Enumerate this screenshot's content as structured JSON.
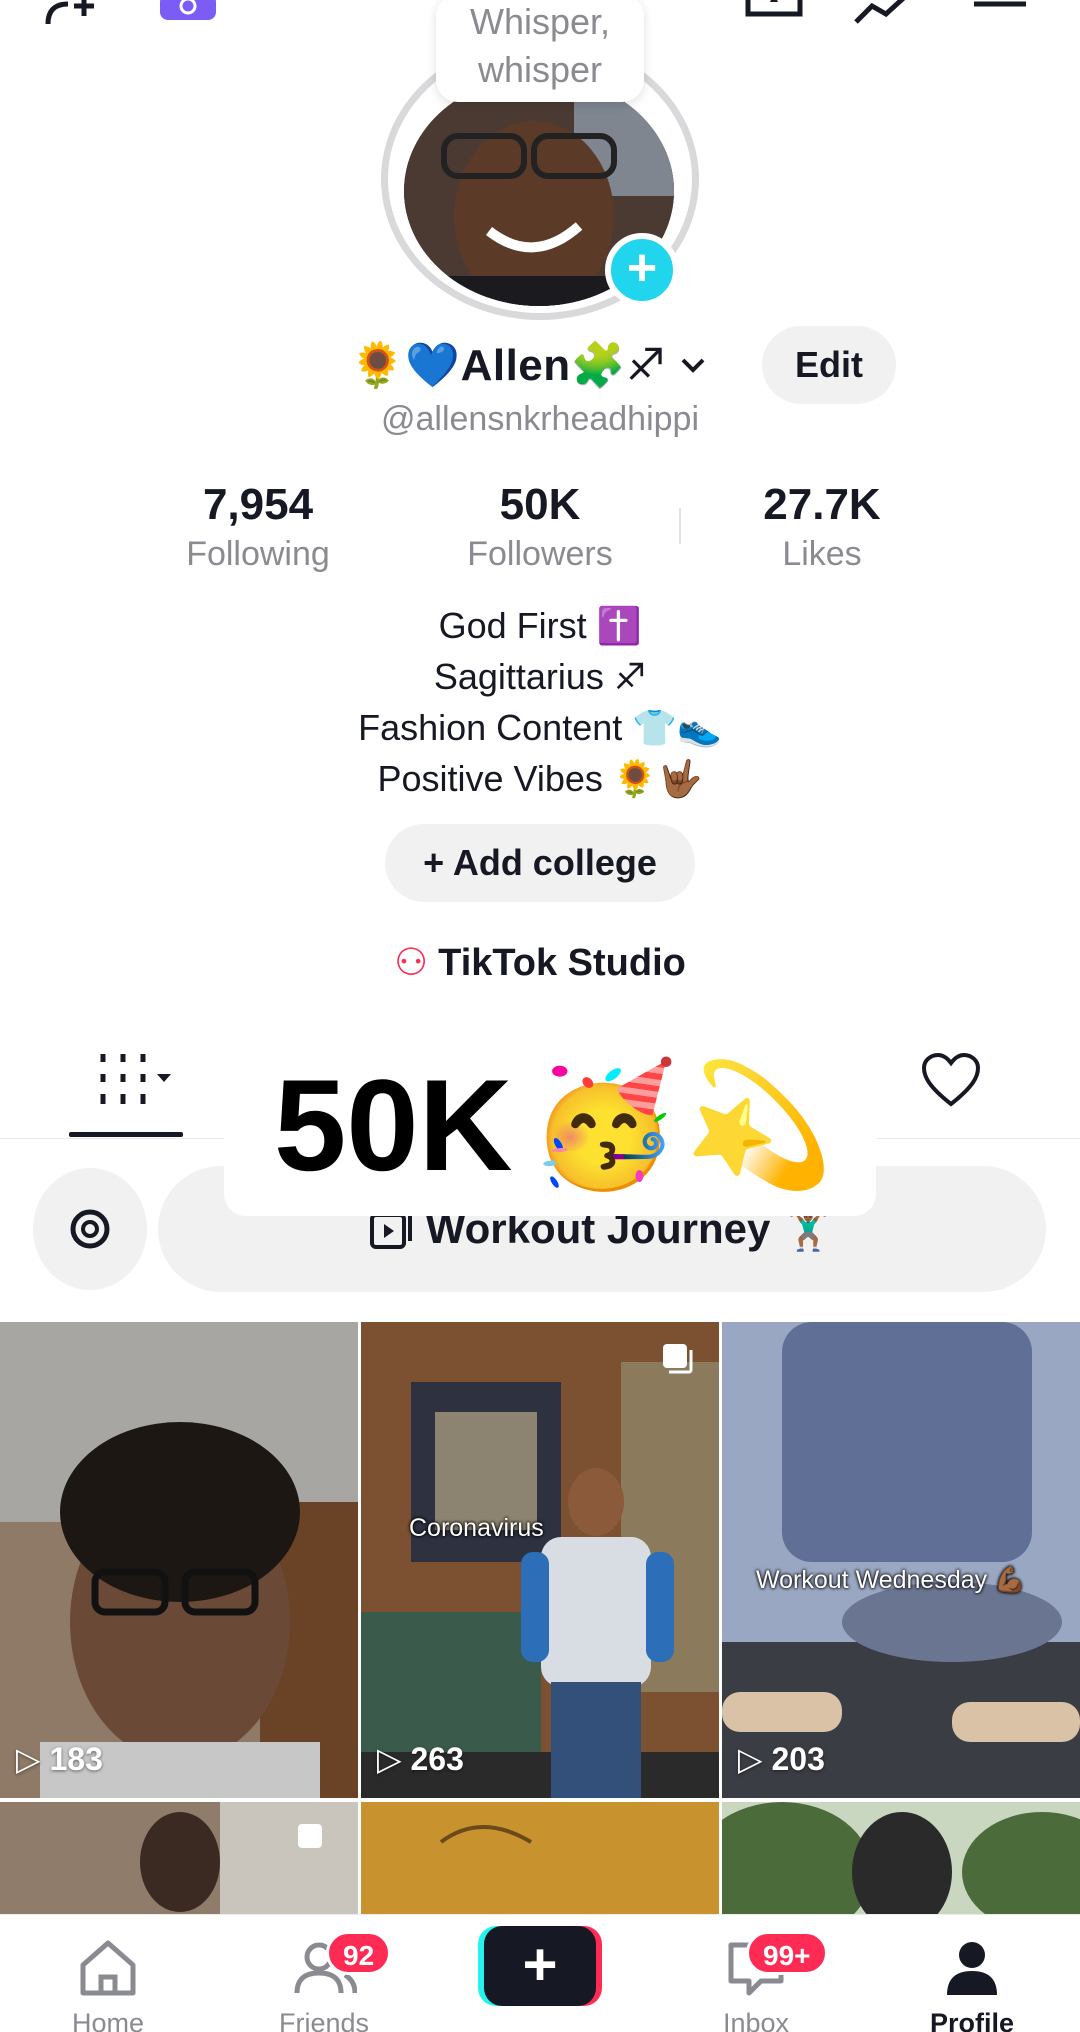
{
  "story_bubble": {
    "text_line1": "Whisper,",
    "text_line2": "whisper"
  },
  "profile": {
    "display_name": "🌻💙Allen🧩♐",
    "edit_label": "Edit",
    "handle": "@allensnkrheadhippi"
  },
  "stats": [
    {
      "value": "7,954",
      "label": "Following"
    },
    {
      "value": "50K",
      "label": "Followers"
    },
    {
      "value": "27.7K",
      "label": "Likes"
    }
  ],
  "bio": [
    "God First ✝️",
    "Sagittarius ♐",
    "Fashion Content 👕👟",
    "Positive Vibes 🌻🤟🏾"
  ],
  "add_college_label": "+ Add college",
  "studio_label": "TikTok Studio",
  "overlay": {
    "text": "50K",
    "emoji1": "🥳",
    "emoji2": "💫"
  },
  "playlist": {
    "label": "Workout Journey 🏋🏾‍♂️"
  },
  "videos": [
    {
      "views": "183",
      "caption": ""
    },
    {
      "views": "263",
      "caption": "Coronavirus"
    },
    {
      "views": "203",
      "caption": "Workout Wednesday 💪🏾"
    }
  ],
  "nav": {
    "home": "Home",
    "friends": "Friends",
    "friends_badge": "92",
    "inbox": "Inbox",
    "inbox_badge": "99+",
    "profile": "Profile",
    "create_symbol": "+"
  },
  "colors": {
    "accent_red": "#fe2c55",
    "accent_cyan": "#25f4ee",
    "plus_blue": "#20d5ec"
  }
}
